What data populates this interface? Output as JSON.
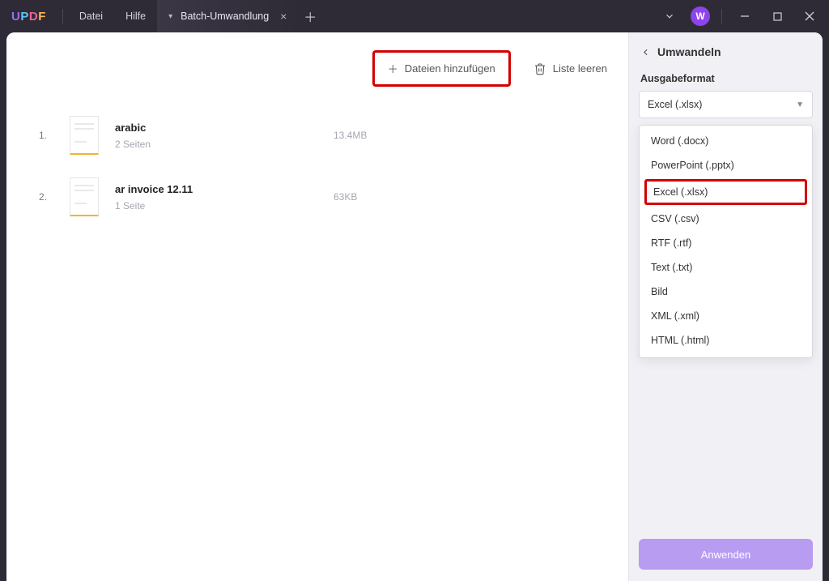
{
  "titlebar": {
    "logo": "UPDF",
    "menu_file": "Datei",
    "menu_help": "Hilfe",
    "tab_label": "Batch-Umwandlung",
    "avatar_letter": "W"
  },
  "toolbar": {
    "add_files": "Dateien hinzufügen",
    "clear_list": "Liste leeren"
  },
  "files": [
    {
      "num": "1.",
      "name": "arabic",
      "sub": "2 Seiten",
      "size": "13.4MB"
    },
    {
      "num": "2.",
      "name": "ar invoice 12.11",
      "sub": "1 Seite",
      "size": "63KB"
    }
  ],
  "sidebar": {
    "title": "Umwandeln",
    "format_label": "Ausgabeformat",
    "selected": "Excel (.xlsx)",
    "options": [
      "Word (.docx)",
      "PowerPoint (.pptx)",
      "Excel (.xlsx)",
      "CSV (.csv)",
      "RTF (.rtf)",
      "Text (.txt)",
      "Bild",
      "XML (.xml)",
      "HTML (.html)"
    ],
    "highlight_index": 2,
    "apply": "Anwenden"
  }
}
